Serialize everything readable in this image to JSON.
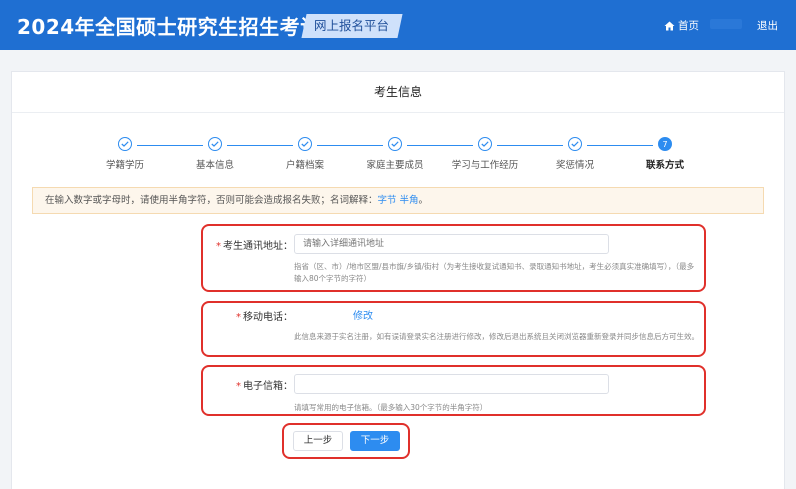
{
  "header": {
    "title": "2024年全国硕士研究生招生考试",
    "platform": "网上报名平台",
    "home": "首页",
    "logout": "退出"
  },
  "page": {
    "title": "考生信息"
  },
  "steps": [
    {
      "label": "学籍学历",
      "status": "done"
    },
    {
      "label": "基本信息",
      "status": "done"
    },
    {
      "label": "户籍档案",
      "status": "done"
    },
    {
      "label": "家庭主要成员",
      "status": "done"
    },
    {
      "label": "学习与工作经历",
      "status": "done"
    },
    {
      "label": "奖惩情况",
      "status": "done"
    },
    {
      "label": "联系方式",
      "status": "active",
      "number": "7"
    }
  ],
  "notice": {
    "text": "在输入数字或字母时，请使用半角字符，否则可能会造成报名失败；名词解释：",
    "links": "字节 半角",
    "end": "。"
  },
  "form": {
    "address": {
      "label": "考生通讯地址：",
      "placeholder": "请输入详细通讯地址",
      "hint": "指省（区、市）/地市区盟/县市旗/乡镇/街村（为考生接收复试通知书、录取通知书地址，考生必须真实准确填写），（最多输入80个字节的字符）"
    },
    "phone": {
      "label": "移动电话：",
      "edit": "修改",
      "hint": "此信息来源于实名注册，如有误请登录实名注册进行修改，修改后退出系统且关闭浏览器重新登录并同步信息后方可生效。"
    },
    "email": {
      "label": "电子信箱：",
      "placeholder": "",
      "hint": "请填写常用的电子信箱。（最多输入30个字节的半角字符）"
    }
  },
  "buttons": {
    "prev": "上一步",
    "next": "下一步"
  },
  "colors": {
    "primary": "#1f6fd2",
    "accent": "#2d8cf0",
    "highlight": "#e0302b",
    "notice_bg": "#fdf6ec"
  }
}
